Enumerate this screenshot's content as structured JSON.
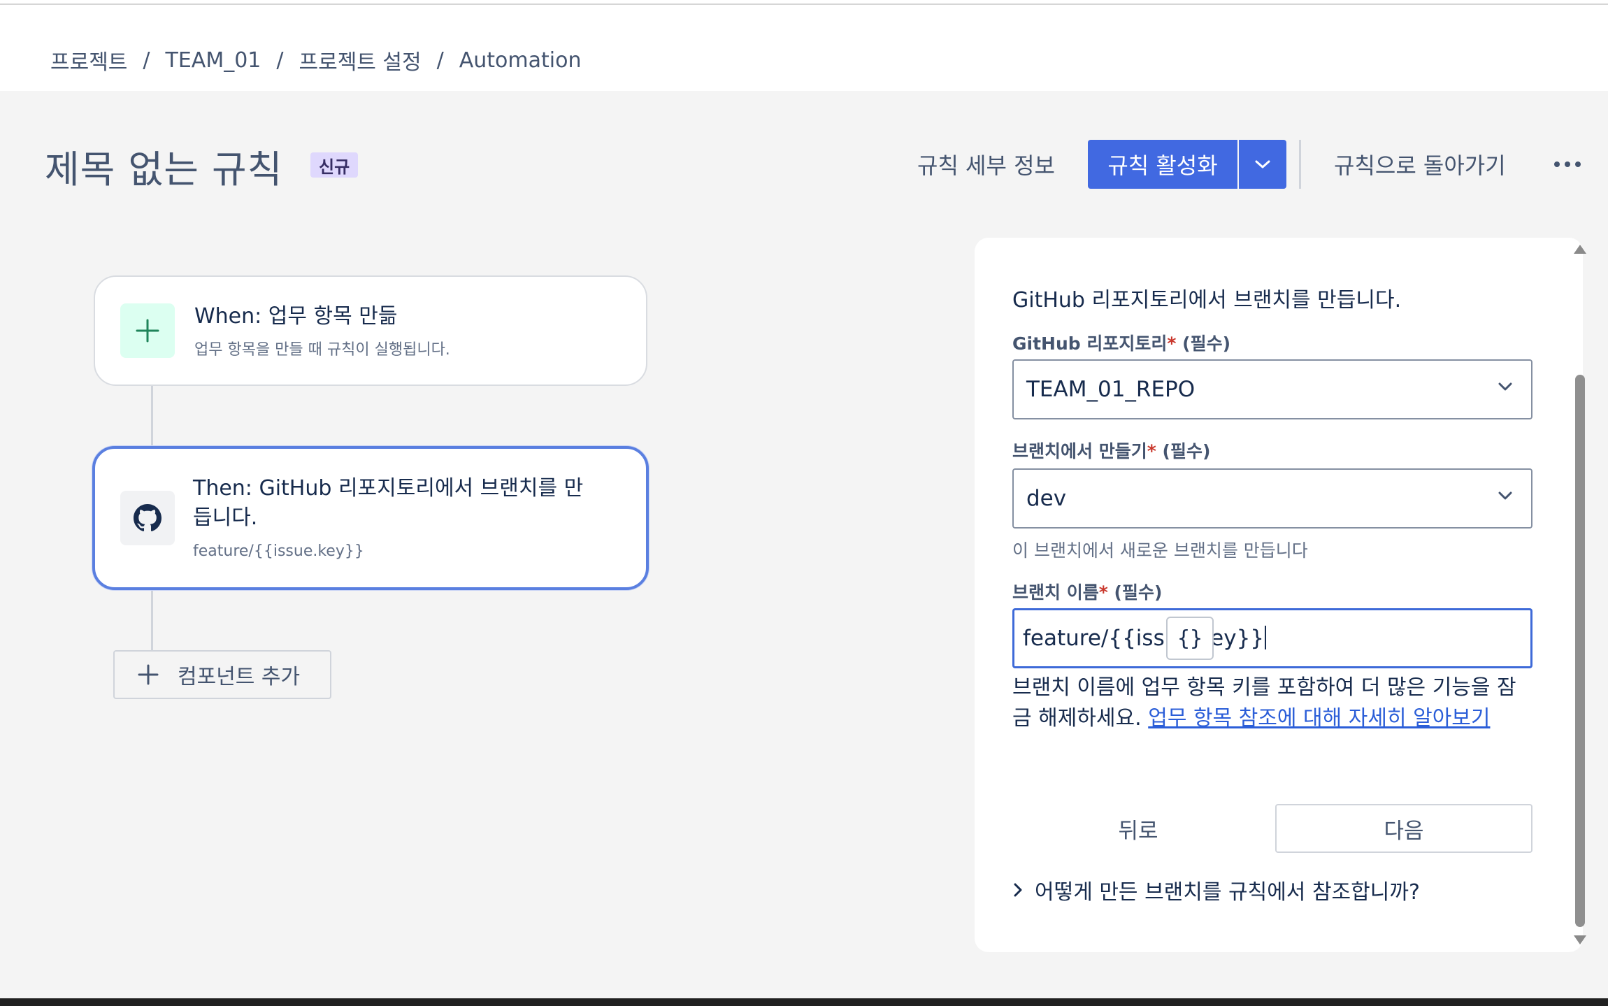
{
  "breadcrumb": {
    "items": [
      "프로젝트",
      "TEAM_01",
      "프로젝트 설정",
      "Automation"
    ],
    "separator": "/"
  },
  "header": {
    "title": "제목 없는 규칙",
    "badge": "신규",
    "rule_details": "규칙 세부 정보",
    "enable_rule": "규칙 활성화",
    "back_to_rules": "규칙으로 돌아가기"
  },
  "flow": {
    "trigger": {
      "title": "When: 업무 항목 만듦",
      "subtitle": "업무 항목을 만들 때 규칙이 실행됩니다.",
      "icon": "plus-icon"
    },
    "action": {
      "title_line1": "Then: GitHub 리포지토리에서 브랜치를 만",
      "title_line2": "듭니다.",
      "subtitle": "feature/{{issue.key}}",
      "icon": "github-icon"
    },
    "add_component": "컴포넌트 추가"
  },
  "panel": {
    "description": "GitHub 리포지토리에서 브랜치를 만듭니다.",
    "required_note": "(필수)",
    "required_mark": "*",
    "repo": {
      "label": "GitHub 리포지토리",
      "value": "TEAM_01_REPO"
    },
    "from_branch": {
      "label": "브랜치에서 만들기",
      "value": "dev",
      "helper": "이 브랜치에서 새로운 브랜치를 만듭니다"
    },
    "branch_name": {
      "label": "브랜치 이름",
      "value": "feature/{{issue.key}}"
    },
    "smart_value_icon": "{}",
    "hint_text": "브랜치 이름에 업무 항목 키를 포함하여 더 많은 기능을 잠금 해제하세요. ",
    "hint_link": "업무 항목 참조에 대해 자세히 알아보기",
    "back": "뒤로",
    "next": "다음",
    "expander": "어떻게 만든 브랜치를 규칙에서 참조합니까?"
  },
  "colors": {
    "primary": "#4169e1",
    "badge_bg": "#dfd8fd",
    "link": "#2b5ed8",
    "trigger_icon_bg": "#dcfff1"
  }
}
